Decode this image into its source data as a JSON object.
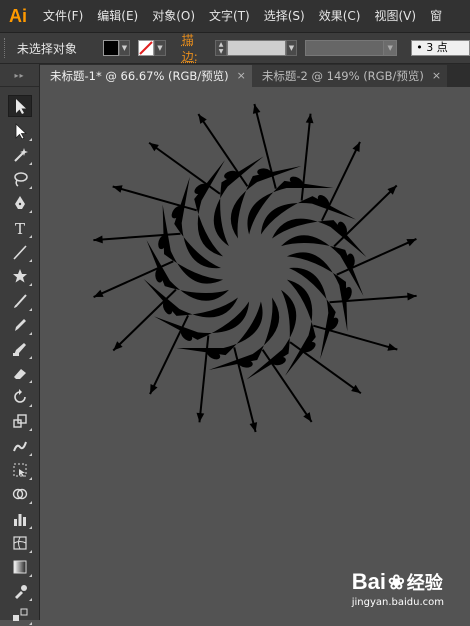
{
  "app": {
    "logo": "Ai"
  },
  "menu": [
    "文件(F)",
    "编辑(E)",
    "对象(O)",
    "文字(T)",
    "选择(S)",
    "效果(C)",
    "视图(V)",
    "窗"
  ],
  "control_bar": {
    "selection_label": "未选择对象",
    "fill_color": "#000000",
    "stroke_label": "描边:",
    "stroke_weight_value": "",
    "point_select": "• 3 点"
  },
  "tabs": [
    {
      "label": "未标题-1* @ 66.67% (RGB/预览)",
      "close": "×",
      "active": true
    },
    {
      "label": "未标题-2 @ 149% (RGB/预览)",
      "close": "×",
      "active": false
    }
  ],
  "tools": [
    {
      "name": "selection-tool-icon",
      "selected": true
    },
    {
      "name": "direct-selection-tool-icon"
    },
    {
      "name": "magic-wand-tool-icon"
    },
    {
      "name": "lasso-tool-icon"
    },
    {
      "name": "pen-tool-icon"
    },
    {
      "name": "type-tool-icon"
    },
    {
      "name": "line-segment-tool-icon"
    },
    {
      "name": "star-tool-icon"
    },
    {
      "name": "paintbrush-tool-icon"
    },
    {
      "name": "pencil-tool-icon"
    },
    {
      "name": "blob-brush-tool-icon"
    },
    {
      "name": "eraser-tool-icon"
    },
    {
      "name": "rotate-tool-icon"
    },
    {
      "name": "scale-tool-icon"
    },
    {
      "name": "warp-tool-icon"
    },
    {
      "name": "free-transform-tool-icon"
    },
    {
      "name": "shape-builder-tool-icon"
    },
    {
      "name": "graph-tool-icon"
    },
    {
      "name": "mesh-tool-icon"
    },
    {
      "name": "gradient-tool-icon"
    },
    {
      "name": "eyedropper-tool-icon"
    },
    {
      "name": "blend-tool-icon"
    }
  ],
  "watermark": {
    "brand": "Bai",
    "brand2": "经验",
    "url": "jingyan.baidu.com"
  }
}
